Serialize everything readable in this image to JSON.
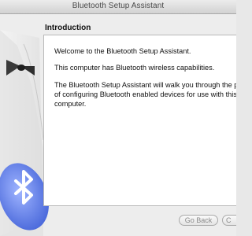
{
  "window": {
    "title": "Bluetooth Setup Assistant"
  },
  "page": {
    "heading": "Introduction",
    "paragraphs": [
      "Welcome to the Bluetooth Setup Assistant.",
      "This computer has Bluetooth wireless capabilities.",
      "The Bluetooth Setup Assistant will walk you through the p",
      "of configuring Bluetooth enabled devices for use with this",
      "computer."
    ]
  },
  "buttons": {
    "back": "Go Back",
    "continue": "C"
  },
  "icons": {
    "art": "tuxedo-icon",
    "logo": "bluetooth-icon"
  },
  "colors": {
    "bluetooth_blue": "#4f6fe0",
    "title_text": "#4a4a4a"
  }
}
